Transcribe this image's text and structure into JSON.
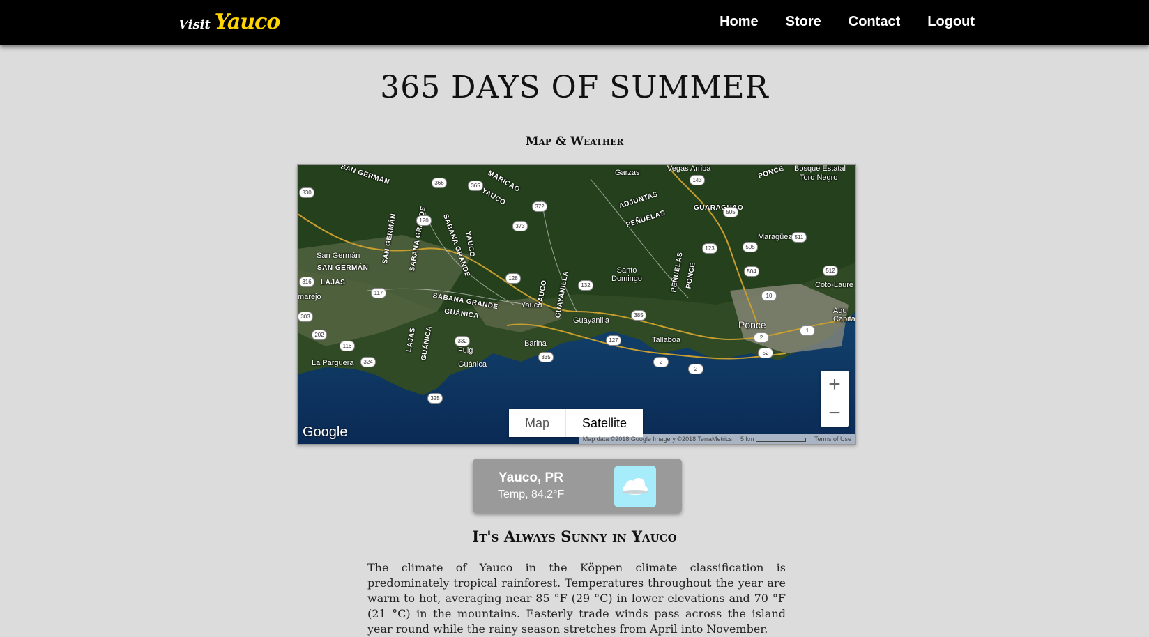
{
  "nav": {
    "brand_prefix": "Visit",
    "brand_name": "Yauco",
    "links": [
      "Home",
      "Store",
      "Contact",
      "Logout"
    ]
  },
  "page": {
    "title": "365 DAYS OF SUMMER",
    "subtitle": "Map & Weather",
    "section_heading": "It's Always Sunny in Yauco",
    "paragraph": "The climate of Yauco in the Köppen climate classification is predominately tropical rainforest. Temperatures throughout the year are warm to hot, averaging near 85 °F (29 °C) in lower elevations and 70 °F (21 °C) in the mountains. Easterly trade winds pass across the island year round while the rainy season stretches from April into November."
  },
  "map": {
    "type_map_label": "Map",
    "type_satellite_label": "Satellite",
    "zoom_in": "+",
    "zoom_out": "−",
    "logo_text": "Google",
    "attribution": "Map data ©2018 Google Imagery ©2018 TerraMetrics",
    "scale_label": "5 km",
    "terms": "Terms of Use",
    "labels": {
      "san_german": "San Germán",
      "san_german_upper": "SAN GERMÁN",
      "lajas": "LAJAS",
      "marejo": "marejo",
      "la_parguera": "La Parguera",
      "sabana_grande": "SABANA GRANDE",
      "guanica": "GUÁNICA",
      "guanica_town": "Guánica",
      "fuig": "Fuig",
      "yauco": "Yauco",
      "yauco_upper": "YAUCO",
      "guayanilla": "Guayanilla",
      "guayanilla_upper": "GUAYANILLA",
      "barina": "Barina",
      "maricao": "MARICAO",
      "adjuntas": "ADJUNTAS",
      "penuelas": "PEÑUELAS",
      "santo_domingo": "Santo\nDomingo",
      "tallaboa": "Tallaboa",
      "ponce": "Ponce",
      "ponce_upper": "PONCE",
      "maraguez": "Maragüez",
      "coto_laurel": "Coto-Laure",
      "garzas": "Garzas",
      "vegas_arriba": "Vegas Arriba",
      "guaraguao": "GUARAGUAO",
      "bosque": "Bosque Estatal",
      "toro_negro": "Toro Negro",
      "capita": "Agu\nCapita"
    },
    "shields": [
      "330",
      "366",
      "365",
      "372",
      "373",
      "120",
      "316",
      "117",
      "303",
      "202",
      "116",
      "324",
      "325",
      "128",
      "132",
      "332",
      "335",
      "385",
      "127",
      "2",
      "2",
      "52",
      "2",
      "10",
      "1",
      "123",
      "505",
      "504",
      "511",
      "512",
      "143",
      "505"
    ]
  },
  "weather": {
    "city": "Yauco, PR",
    "temp": "Temp, 84.2°F",
    "icon": "cloud-icon"
  }
}
